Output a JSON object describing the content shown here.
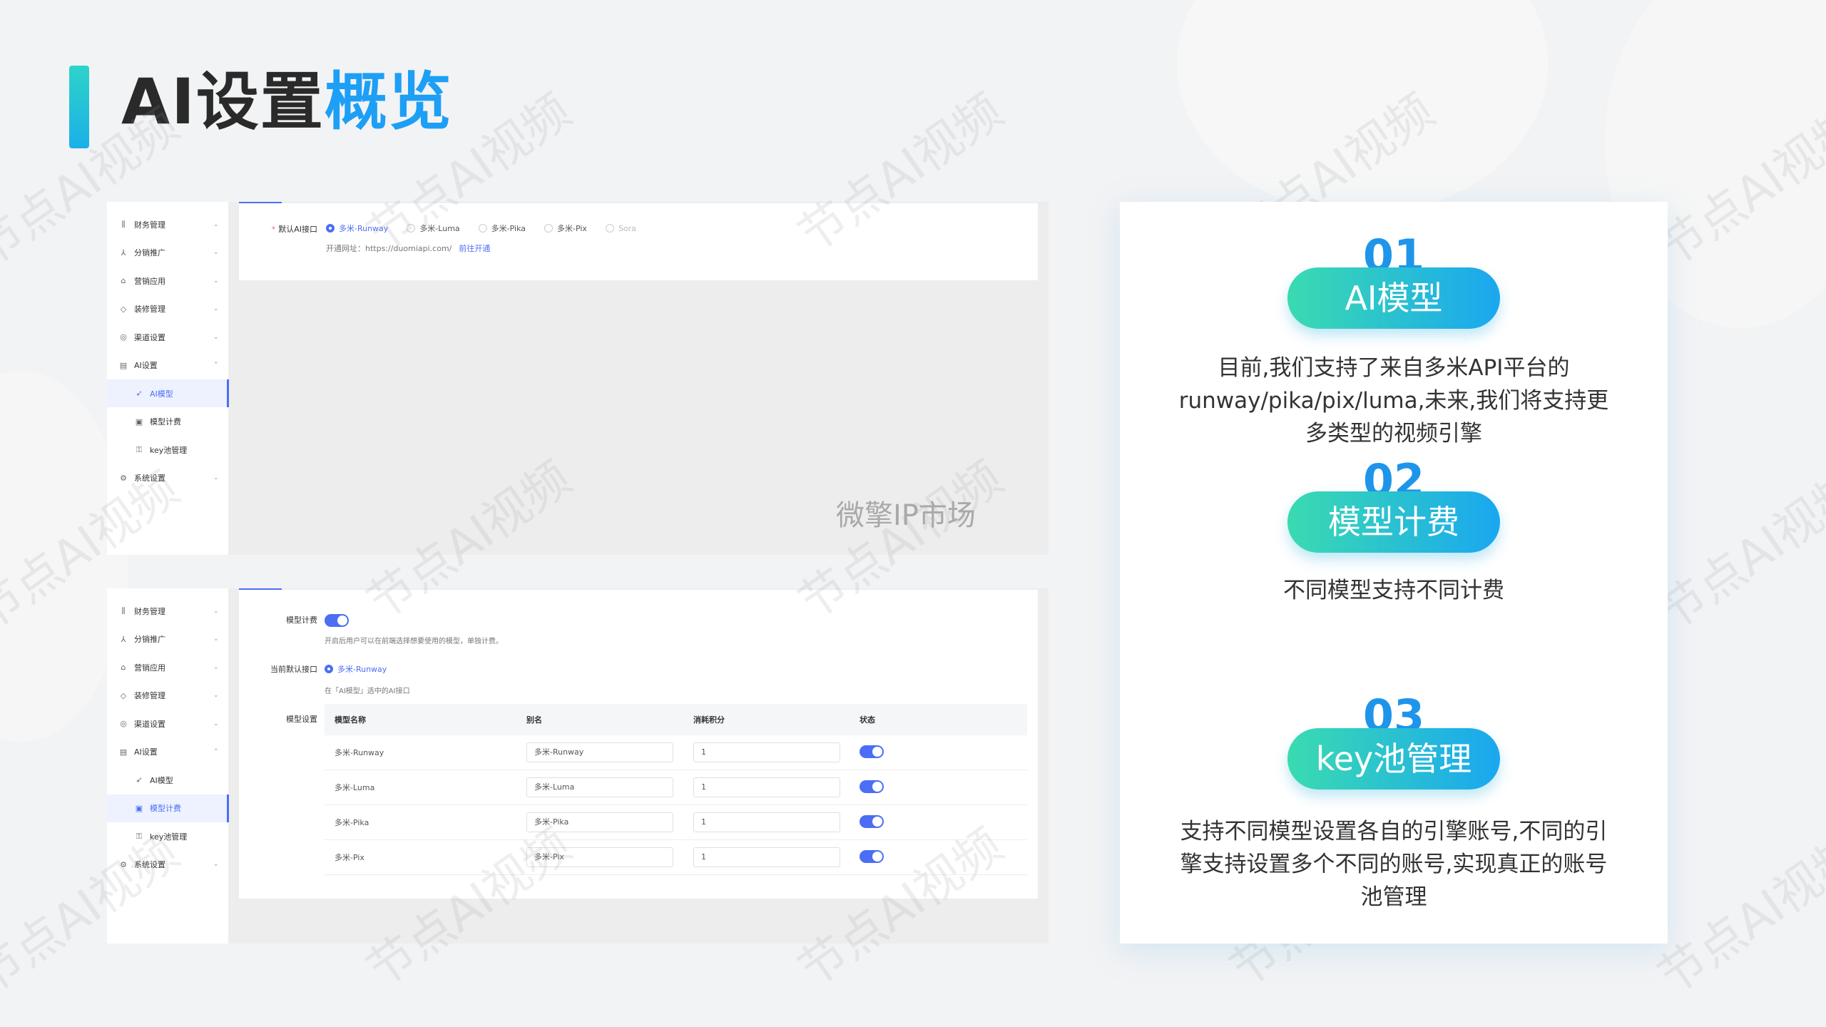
{
  "title": {
    "part1": "AI设置",
    "part2": "概览"
  },
  "watermark_text": "节点AI视频",
  "center_mark": "微擎IP市场",
  "shot1": {
    "menu": [
      {
        "icon": "bar-chart-icon",
        "glyph": "⫼",
        "label": "财务管理",
        "chev": "⌄"
      },
      {
        "icon": "share-icon",
        "glyph": "⅄",
        "label": "分销推广",
        "chev": "⌄"
      },
      {
        "icon": "shop-icon",
        "glyph": "⌂",
        "label": "营销应用",
        "chev": "⌄"
      },
      {
        "icon": "decor-icon",
        "glyph": "◇",
        "label": "装修管理",
        "chev": "⌄"
      },
      {
        "icon": "channel-icon",
        "glyph": "◎",
        "label": "渠道设置",
        "chev": "⌄"
      },
      {
        "icon": "ai-settings-icon",
        "glyph": "▤",
        "label": "AI设置",
        "chev": "⌃"
      },
      {
        "icon": "rocket-icon",
        "glyph": "➶",
        "label": "AI模型",
        "chev": ""
      },
      {
        "icon": "billing-icon",
        "glyph": "▣",
        "label": "模型计费",
        "chev": ""
      },
      {
        "icon": "key-icon",
        "glyph": "⚿",
        "label": "key池管理",
        "chev": ""
      },
      {
        "icon": "gear-icon",
        "glyph": "⚙",
        "label": "系统设置",
        "chev": "⌄"
      }
    ],
    "default_api_label": "默认AI接口",
    "options": [
      "多米-Runway",
      "多米-Luma",
      "多米-Pika",
      "多米-Pix",
      "Sora"
    ],
    "selected": "多米-Runway",
    "open_url_label": "开通网址：https://duomiapi.com/",
    "open_link": "前往开通"
  },
  "shot2": {
    "menu": [
      {
        "icon": "bar-chart-icon",
        "glyph": "⫼",
        "label": "财务管理",
        "chev": "⌄"
      },
      {
        "icon": "share-icon",
        "glyph": "⅄",
        "label": "分销推广",
        "chev": "⌄"
      },
      {
        "icon": "shop-icon",
        "glyph": "⌂",
        "label": "营销应用",
        "chev": "⌄"
      },
      {
        "icon": "decor-icon",
        "glyph": "◇",
        "label": "装修管理",
        "chev": "⌄"
      },
      {
        "icon": "channel-icon",
        "glyph": "◎",
        "label": "渠道设置",
        "chev": "⌄"
      },
      {
        "icon": "ai-settings-icon",
        "glyph": "▤",
        "label": "AI设置",
        "chev": "⌃"
      },
      {
        "icon": "rocket-icon",
        "glyph": "➶",
        "label": "AI模型",
        "chev": ""
      },
      {
        "icon": "billing-icon",
        "glyph": "▣",
        "label": "模型计费",
        "chev": ""
      },
      {
        "icon": "key-icon",
        "glyph": "⚿",
        "label": "key池管理",
        "chev": ""
      },
      {
        "icon": "gear-icon",
        "glyph": "⚙",
        "label": "系统设置",
        "chev": "⌄"
      }
    ],
    "billing_label": "模型计费",
    "billing_hint": "开启后用户可以在前端选择想要使用的模型，单独计费。",
    "current_api_label": "当前默认接口",
    "current_api_value": "多米-Runway",
    "current_api_hint": "在「AI模型」选中的AI接口",
    "model_settings_label": "模型设置",
    "columns": [
      "模型名称",
      "别名",
      "消耗积分",
      "状态"
    ],
    "rows": [
      {
        "name": "多米-Runway",
        "alias": "多米-Runway",
        "points": "1"
      },
      {
        "name": "多米-Luma",
        "alias": "多米-Luma",
        "points": "1"
      },
      {
        "name": "多米-Pika",
        "alias": "多米-Pika",
        "points": "1"
      },
      {
        "name": "多米-Pix",
        "alias": "多米-Pix",
        "points": "1"
      }
    ]
  },
  "features": [
    {
      "num": "01",
      "title": "AI模型",
      "desc": "目前,我们支持了来自多米API平台的runway/pika/pix/luma,未来,我们将支持更多类型的视频引擎"
    },
    {
      "num": "02",
      "title": "模型计费",
      "desc": "不同模型支持不同计费"
    },
    {
      "num": "03",
      "title": "key池管理",
      "desc": "支持不同模型设置各自的引擎账号,不同的引擎支持设置多个不同的账号,实现真正的账号池管理"
    }
  ],
  "colors": {
    "accent": "#4c6ef5",
    "title_blue": "#1d9ff5",
    "pill_start": "#3adbb0",
    "pill_end": "#1aa7f0"
  }
}
